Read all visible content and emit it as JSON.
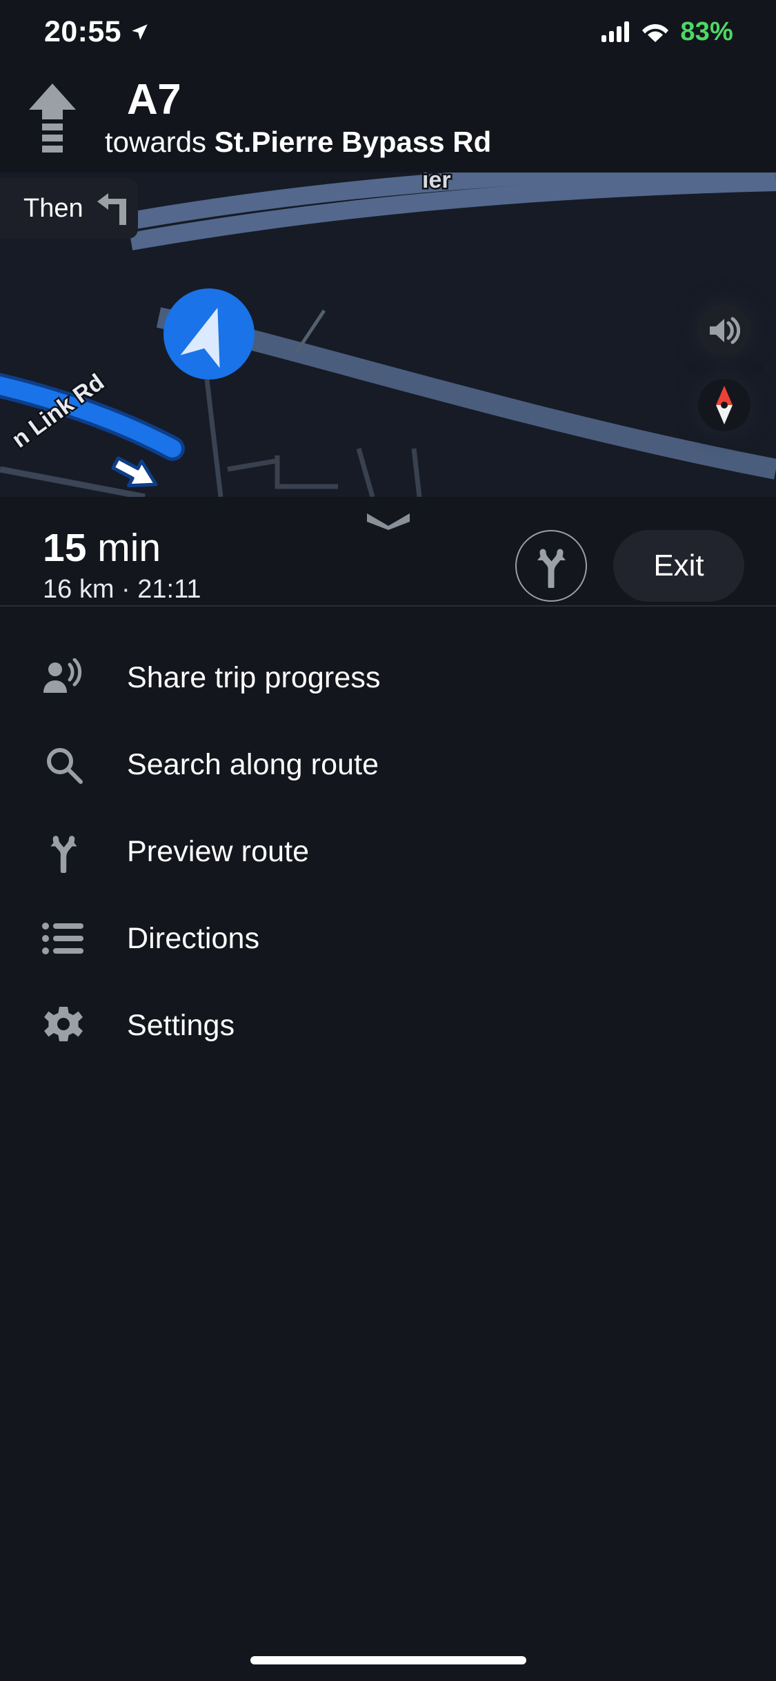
{
  "status_bar": {
    "time": "20:55",
    "location_icon": "location-arrow-icon",
    "signal_icon": "cellular-signal-icon",
    "wifi_icon": "wifi-icon",
    "battery": "83%",
    "battery_color": "#4cd964"
  },
  "nav_header": {
    "maneuver_icon": "straight-ahead-arrow-icon",
    "road": "A7",
    "towards_prefix": "towards",
    "destination_road": "St.Pierre Bypass Rd"
  },
  "then_banner": {
    "label": "Then",
    "icon": "turn-left-arrow-icon"
  },
  "map": {
    "road_labels": [
      "n Link Rd",
      "ier"
    ],
    "route_color": "#1a73e8",
    "road_color": "#5a7296",
    "background_color": "#161b26",
    "puck_color": "#1a73e8",
    "controls": [
      {
        "name": "volume-button",
        "icon": "speaker-icon"
      },
      {
        "name": "compass-button",
        "icon": "compass-needle-icon"
      }
    ]
  },
  "trip": {
    "duration_value": "15",
    "duration_unit": "min",
    "distance_and_eta": "16 km · 21:11",
    "route_alternatives_icon": "route-fork-icon",
    "exit_label": "Exit",
    "grabber_icon": "chevron-down-icon"
  },
  "menu": {
    "items": [
      {
        "label": "Share trip progress",
        "icon": "share-person-broadcast-icon"
      },
      {
        "label": "Search along route",
        "icon": "search-icon"
      },
      {
        "label": "Preview route",
        "icon": "route-fork-icon"
      },
      {
        "label": "Directions",
        "icon": "list-bullet-icon"
      },
      {
        "label": "Settings",
        "icon": "gear-icon"
      }
    ]
  }
}
